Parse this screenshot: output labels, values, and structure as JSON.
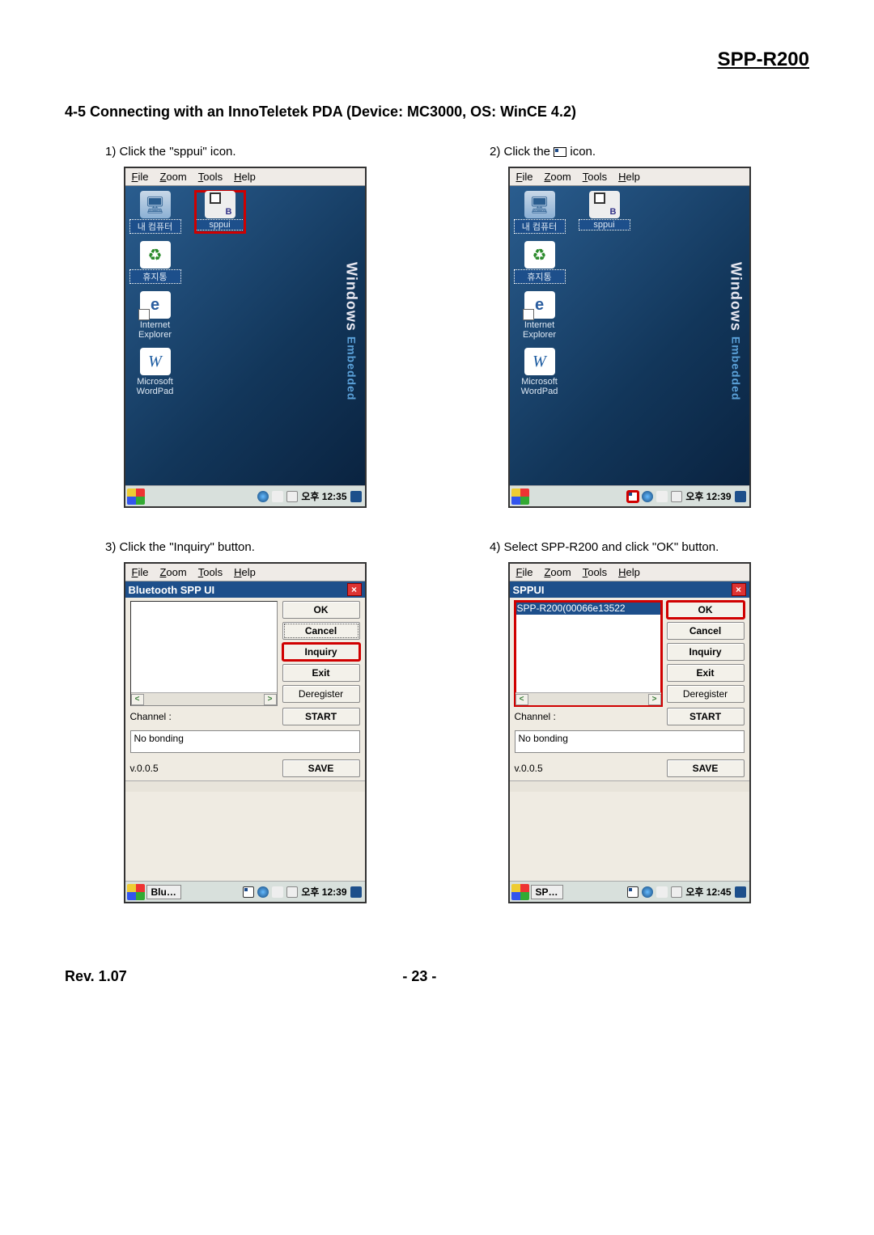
{
  "doc": {
    "model": "SPP-R200",
    "section": "4-5 Connecting with an InnoTeletek PDA (Device: MC3000, OS: WinCE 4.2)",
    "revision": "Rev. 1.07",
    "page": "- 23 -"
  },
  "steps": {
    "s1": "1) Click the \"sppui\" icon.",
    "s2a": "2) Click the ",
    "s2b": " icon.",
    "s3": "3) Click the \"Inquiry\" button.",
    "s4": "4) Select SPP-R200 and click \"OK\" button."
  },
  "menubar": {
    "file": "File",
    "zoom": "Zoom",
    "tools": "Tools",
    "help": "Help"
  },
  "desktop": {
    "mycomputer": "내 컴퓨터",
    "sppui": "sppui",
    "recycle": "휴지통",
    "ie": "Internet\nExplorer",
    "wordpad": "Microsoft\nWordPad",
    "watermark_main": "Windows",
    "watermark_sub": "Embedded"
  },
  "taskbar": {
    "time1": "오후 12:35",
    "time2": "오후 12:39",
    "time3": "오후 12:39",
    "time4": "오후 12:45",
    "blu": "Blu…",
    "sp": "SP…"
  },
  "sppui_app": {
    "title_a": "Bluetooth SPP UI",
    "title_b": "SPPUI",
    "ok": "OK",
    "cancel": "Cancel",
    "inquiry": "Inquiry",
    "exit": "Exit",
    "deregister": "Deregister",
    "start": "START",
    "channel": "Channel :",
    "nobonding": "No bonding",
    "version": "v.0.0.5",
    "save": "SAVE",
    "list_item": "SPP-R200(00066e13522",
    "scroll_left": "<",
    "scroll_right": ">"
  }
}
